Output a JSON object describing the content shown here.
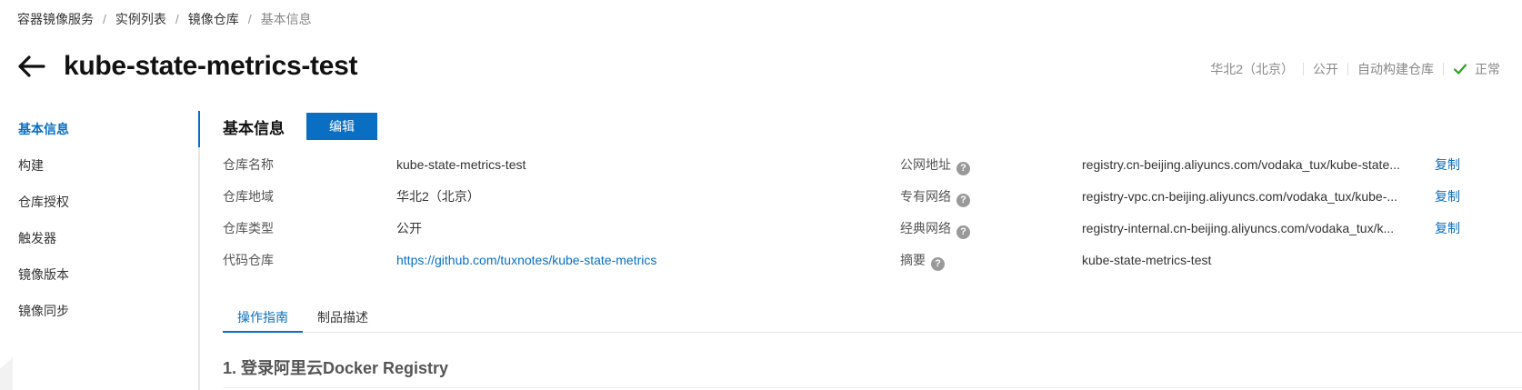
{
  "breadcrumb": [
    "容器镜像服务",
    "实例列表",
    "镜像仓库",
    "基本信息"
  ],
  "title": "kube-state-metrics-test",
  "meta": {
    "region": "华北2（北京）",
    "visibility": "公开",
    "build": "自动构建仓库",
    "status": "正常"
  },
  "sidebar": {
    "items": [
      {
        "label": "基本信息"
      },
      {
        "label": "构建"
      },
      {
        "label": "仓库授权"
      },
      {
        "label": "触发器"
      },
      {
        "label": "镜像版本"
      },
      {
        "label": "镜像同步"
      }
    ]
  },
  "section": {
    "title": "基本信息",
    "edit_label": "编辑"
  },
  "left_info": [
    {
      "label": "仓库名称",
      "value": "kube-state-metrics-test"
    },
    {
      "label": "仓库地域",
      "value": "华北2（北京）"
    },
    {
      "label": "仓库类型",
      "value": "公开"
    },
    {
      "label": "代码仓库",
      "value": "https://github.com/tuxnotes/kube-state-metrics"
    }
  ],
  "right_info": [
    {
      "label": "公网地址",
      "value": "registry.cn-beijing.aliyuncs.com/vodaka_tux/kube-state...",
      "action": "复制"
    },
    {
      "label": "专有网络",
      "value": "registry-vpc.cn-beijing.aliyuncs.com/vodaka_tux/kube-...",
      "action": "复制"
    },
    {
      "label": "经典网络",
      "value": "registry-internal.cn-beijing.aliyuncs.com/vodaka_tux/k...",
      "action": "复制"
    },
    {
      "label": "摘要",
      "value": "kube-state-metrics-test"
    }
  ],
  "help_glyph": "?",
  "tabs": [
    {
      "label": "操作指南"
    },
    {
      "label": "制品描述"
    }
  ],
  "step_title": "1. 登录阿里云Docker Registry",
  "colors": {
    "accent": "#0a6fc2",
    "success": "#2ea121"
  },
  "icons": {
    "back": "arrow-left-icon",
    "status": "check-icon",
    "help": "question-circle-icon"
  }
}
